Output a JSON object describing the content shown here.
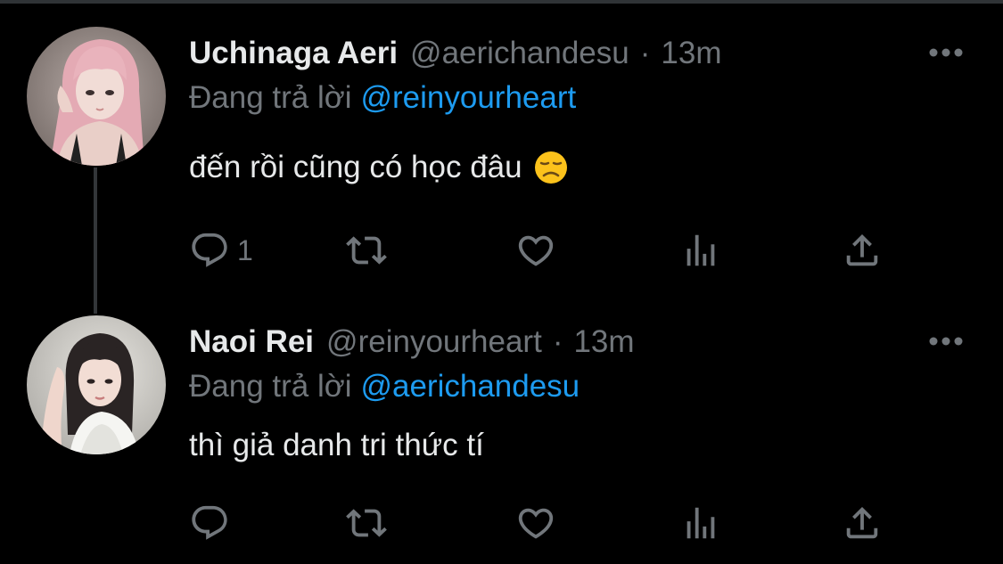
{
  "colors": {
    "background": "#000000",
    "text_primary": "#e7e9ea",
    "text_secondary": "#71767b",
    "link": "#1d9bf0",
    "thread_line": "#333639"
  },
  "tweets": [
    {
      "display_name": "Uchinaga Aeri",
      "handle": "@aerichandesu",
      "separator": "·",
      "time": "13m",
      "reply_prefix": "Đang trả lời",
      "reply_to": "@reinyourheart",
      "text": "đến rồi cũng có học đâu",
      "emoji": "disappointed-face",
      "reply_count": "1",
      "icons": [
        "reply-icon",
        "retweet-icon",
        "like-icon",
        "views-icon",
        "share-icon",
        "more-icon"
      ]
    },
    {
      "display_name": "Naoi Rei",
      "handle": "@reinyourheart",
      "separator": "·",
      "time": "13m",
      "reply_prefix": "Đang trả lời",
      "reply_to": "@aerichandesu",
      "text": "thì giả danh tri thức tí",
      "reply_count": "",
      "icons": [
        "reply-icon",
        "retweet-icon",
        "like-icon",
        "views-icon",
        "share-icon",
        "more-icon"
      ]
    }
  ]
}
